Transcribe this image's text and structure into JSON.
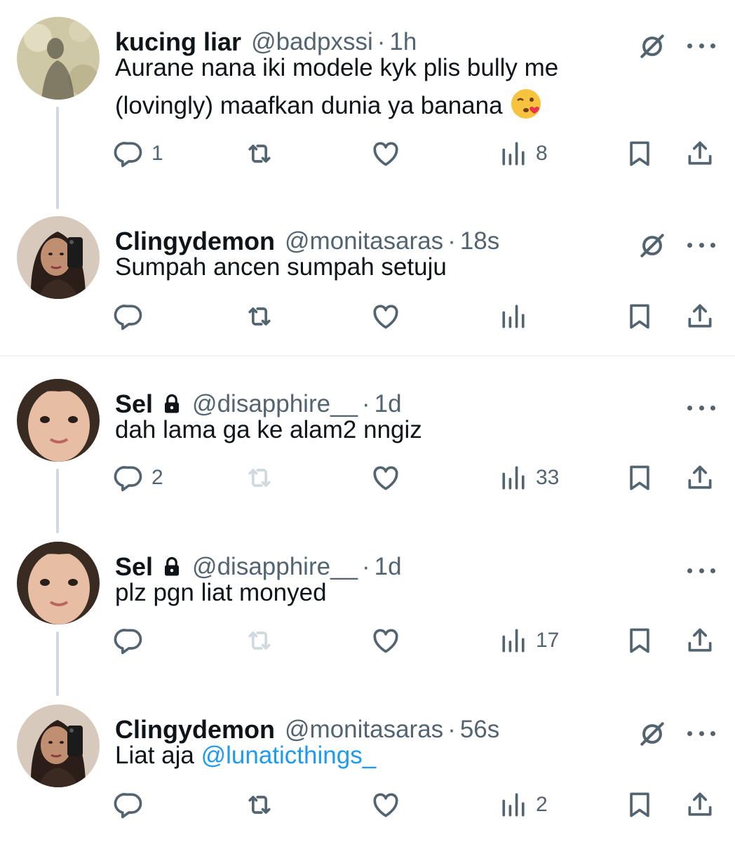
{
  "tweets": [
    {
      "name": "kucing liar",
      "handle": "@badpxssi",
      "separator": "·",
      "time": "1h",
      "text_line1": "Aurane nana iki modele kyk plis bully me",
      "text_line2": "(lovingly) maafkan dunia ya banana",
      "emoji": "kissing-wink-face",
      "replies": "1",
      "reposts": "",
      "likes": "",
      "views": "8"
    },
    {
      "name": "Clingydemon",
      "handle": "@monitasaras",
      "separator": "·",
      "time": "18s",
      "text": "Sumpah ancen sumpah setuju",
      "replies": "",
      "reposts": "",
      "likes": "",
      "views": ""
    },
    {
      "name": "Sel",
      "handle": "@disapphire__",
      "separator": "·",
      "time": "1d",
      "text": "dah lama ga ke alam2 nngiz",
      "replies": "2",
      "reposts": "",
      "likes": "",
      "views": "33"
    },
    {
      "name": "Sel",
      "handle": "@disapphire__",
      "separator": "·",
      "time": "1d",
      "text": "plz pgn liat monyed",
      "replies": "",
      "reposts": "",
      "likes": "",
      "views": "17"
    },
    {
      "name": "Clingydemon",
      "handle": "@monitasaras",
      "separator": "·",
      "time": "56s",
      "text_prefix": "Liat aja ",
      "mention": "@lunaticthings_",
      "replies": "",
      "reposts": "",
      "likes": "",
      "views": "2"
    }
  ],
  "colors": {
    "text": "#0f1419",
    "secondary": "#536471",
    "link": "#1d9bf0",
    "disabled": "#cfd9de",
    "thread_line": "#cfd9de"
  },
  "icons": [
    "reply-icon",
    "repost-icon",
    "like-icon",
    "views-icon",
    "bookmark-icon",
    "share-icon",
    "grok-icon",
    "more-icon",
    "lock-icon"
  ]
}
